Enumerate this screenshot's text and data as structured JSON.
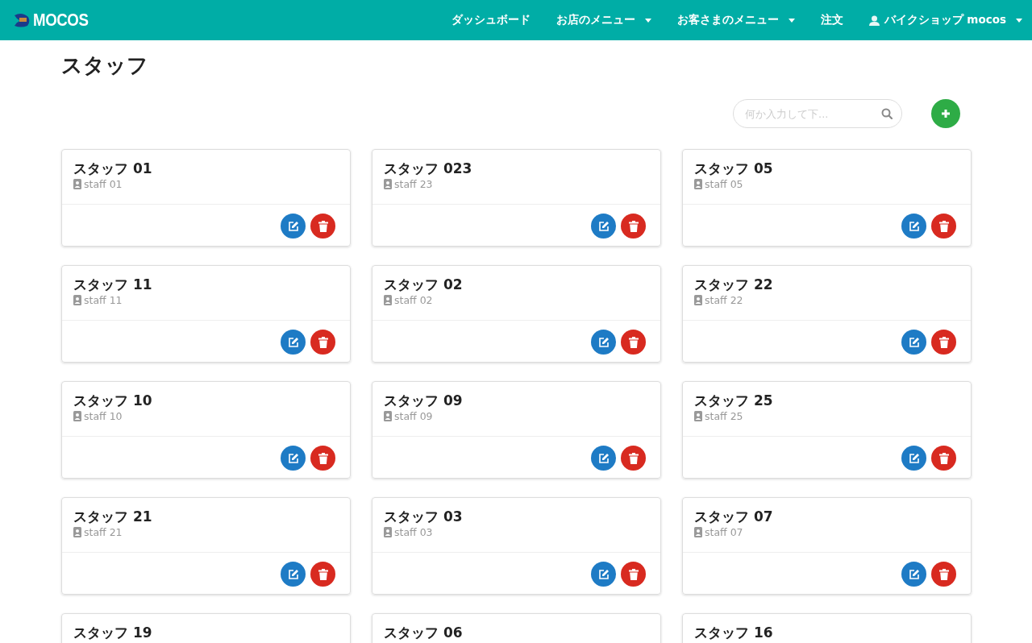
{
  "navbar": {
    "brand": "MOCOS",
    "items": [
      {
        "label": "ダッシュボード",
        "dropdown": false,
        "user": false
      },
      {
        "label": "お店のメニュー",
        "dropdown": true,
        "user": false
      },
      {
        "label": "お客さまのメニュー",
        "dropdown": true,
        "user": false
      },
      {
        "label": "注文",
        "dropdown": false,
        "user": false
      },
      {
        "label": "バイクショップ mocos",
        "dropdown": true,
        "user": true
      }
    ]
  },
  "page": {
    "title": "スタッフ",
    "search": {
      "placeholder": "何か入力して下..."
    }
  },
  "staff": [
    {
      "name": "スタッフ 01",
      "login": "staff 01"
    },
    {
      "name": "スタッフ 023",
      "login": "staff 23"
    },
    {
      "name": "スタッフ 05",
      "login": "staff 05"
    },
    {
      "name": "スタッフ 11",
      "login": "staff 11"
    },
    {
      "name": "スタッフ 02",
      "login": "staff 02"
    },
    {
      "name": "スタッフ 22",
      "login": "staff 22"
    },
    {
      "name": "スタッフ 10",
      "login": "staff 10"
    },
    {
      "name": "スタッフ 09",
      "login": "staff 09"
    },
    {
      "name": "スタッフ 25",
      "login": "staff 25"
    },
    {
      "name": "スタッフ 21",
      "login": "staff 21"
    },
    {
      "name": "スタッフ 03",
      "login": "staff 03"
    },
    {
      "name": "スタッフ 07",
      "login": "staff 07"
    },
    {
      "name": "スタッフ 19"
    },
    {
      "name": "スタッフ 06"
    },
    {
      "name": "スタッフ 16"
    }
  ]
}
